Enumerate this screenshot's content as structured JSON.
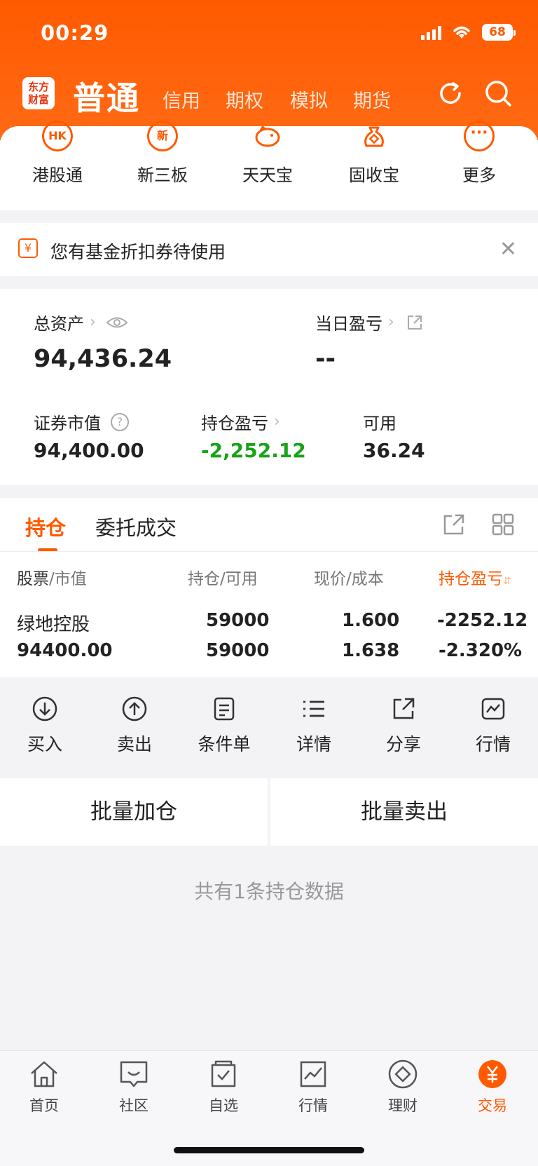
{
  "status_bar": {
    "time": "00:29",
    "battery": "68"
  },
  "header": {
    "logo_line1": "东方",
    "logo_line2": "财富",
    "main_tab": "普通",
    "tabs": [
      "信用",
      "期权",
      "模拟",
      "期货"
    ]
  },
  "shortcuts": [
    {
      "icon": "hk-icon",
      "glyph": "HK",
      "label": "港股通"
    },
    {
      "icon": "new-icon",
      "glyph": "新",
      "label": "新三板"
    },
    {
      "icon": "piggy-icon",
      "glyph": "",
      "label": "天天宝"
    },
    {
      "icon": "moneybag-icon",
      "glyph": "",
      "label": "固收宝"
    },
    {
      "icon": "more-icon",
      "glyph": "···",
      "label": "更多"
    }
  ],
  "notice": {
    "text": "您有基金折扣券待使用",
    "icon_glyph": "¥"
  },
  "assets": {
    "total_label": "总资产",
    "total_value": "94,436.24",
    "daily_pnl_label": "当日盈亏",
    "daily_pnl_value": "--",
    "market_value_label": "证券市值",
    "market_value": "94,400.00",
    "position_pnl_label": "持仓盈亏",
    "position_pnl_value": "-2,252.12",
    "available_label": "可用",
    "available_value": "36.24"
  },
  "positions": {
    "tabs": [
      "持仓",
      "委托成交"
    ],
    "columns": {
      "c1a": "股票",
      "c1b": "市值",
      "c2a": "持仓",
      "c2b": "可用",
      "c3a": "现价",
      "c3b": "成本",
      "c4": "持仓盈亏"
    },
    "rows": [
      {
        "name": "绿地控股",
        "market_value": "94400.00",
        "holding": "59000",
        "available": "59000",
        "price": "1.600",
        "cost": "1.638",
        "pnl": "-2252.12",
        "pnl_pct": "-2.320%"
      }
    ]
  },
  "actions": [
    "买入",
    "卖出",
    "条件单",
    "详情",
    "分享",
    "行情"
  ],
  "batch": {
    "add": "批量加仓",
    "sell": "批量卖出"
  },
  "footnote": "共有1条持仓数据",
  "tabbar": [
    "首页",
    "社区",
    "自选",
    "行情",
    "理财",
    "交易"
  ],
  "colors": {
    "brand": "#ff5a00",
    "loss_green": "#1aa31a"
  }
}
